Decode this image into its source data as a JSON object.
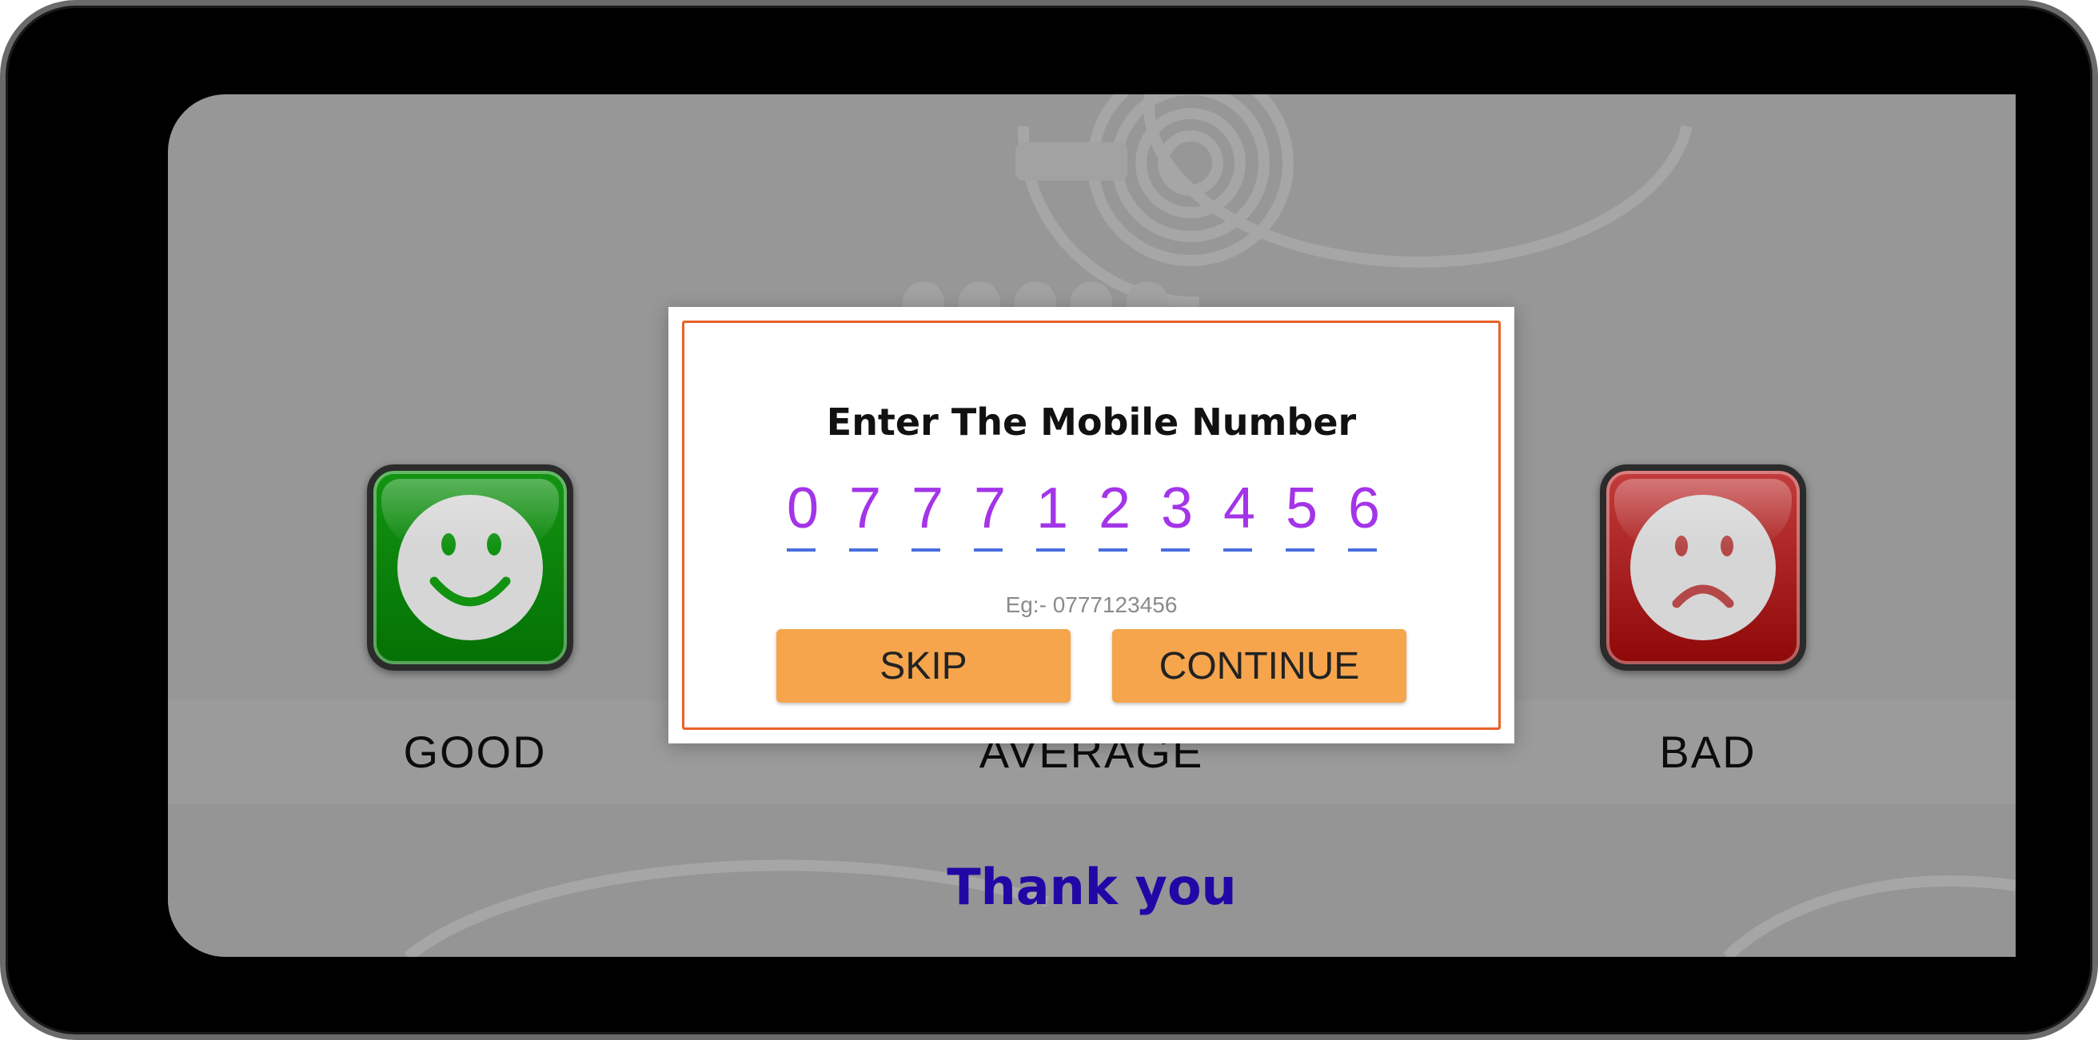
{
  "ratings": {
    "good": {
      "label": "GOOD",
      "icon": "smiley-happy-icon",
      "color": "#0a8a0a"
    },
    "average": {
      "label": "AVERAGE"
    },
    "bad": {
      "label": "BAD",
      "icon": "smiley-sad-icon",
      "color": "#b51818"
    }
  },
  "footer": {
    "thank_you": "Thank you"
  },
  "dialog": {
    "title": "Enter The Mobile Number",
    "digits": [
      "0",
      "7",
      "7",
      "7",
      "1",
      "2",
      "3",
      "4",
      "5",
      "6"
    ],
    "hint": "Eg:- 0777123456",
    "skip_label": "SKIP",
    "continue_label": "CONTINUE",
    "border_color": "#e96128",
    "button_color": "#f6a54d"
  }
}
